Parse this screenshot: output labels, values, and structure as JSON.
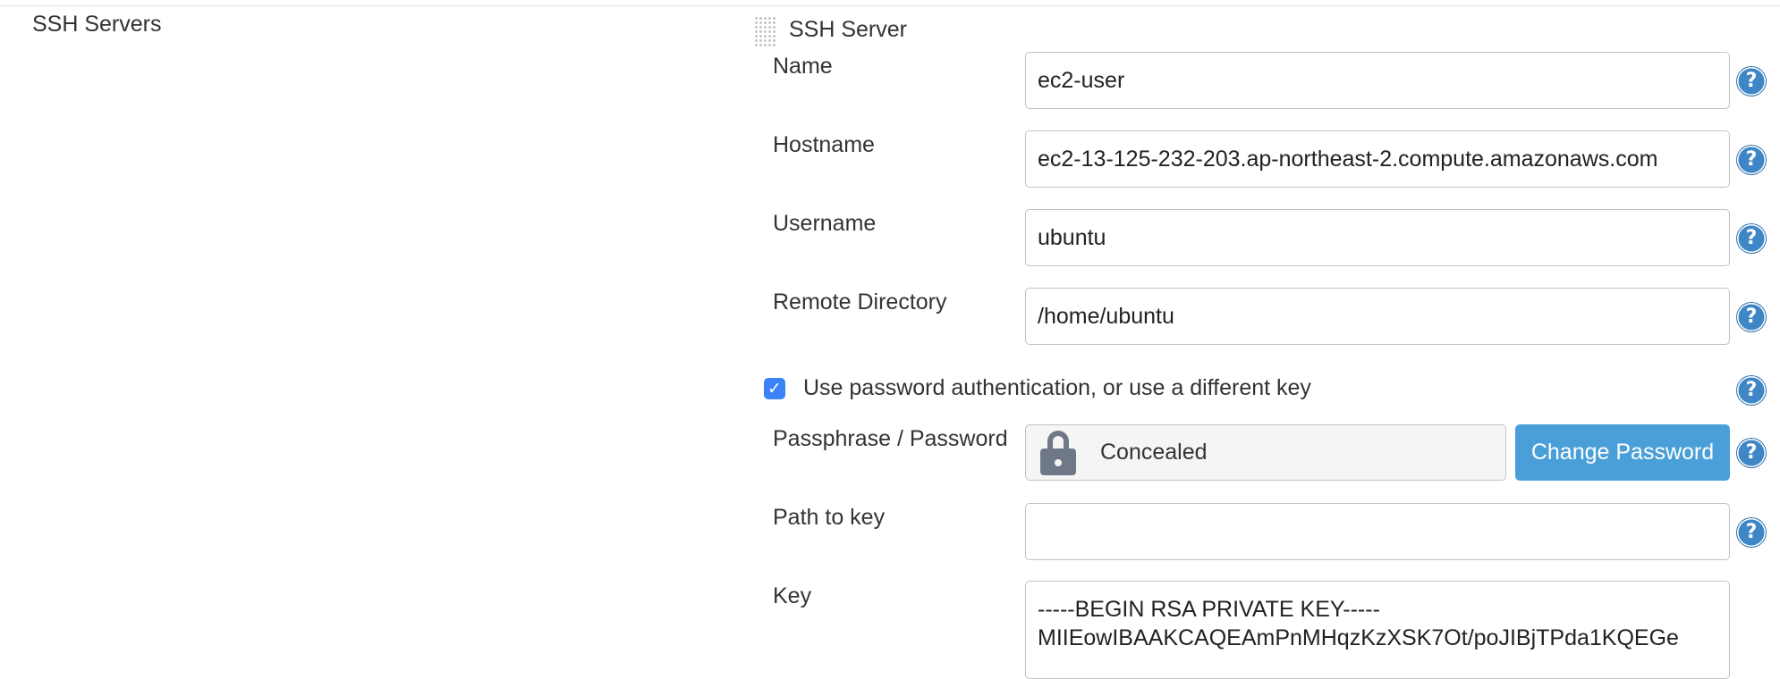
{
  "section": {
    "title": "SSH Servers"
  },
  "server": {
    "title": "SSH Server",
    "name_label": "Name",
    "name_value": "ec2-user",
    "hostname_label": "Hostname",
    "hostname_value": "ec2-13-125-232-203.ap-northeast-2.compute.amazonaws.com",
    "username_label": "Username",
    "username_value": "ubuntu",
    "remote_dir_label": "Remote Directory",
    "remote_dir_value": "/home/ubuntu",
    "use_password_label": "Use password authentication, or use a different key",
    "use_password_checked": true,
    "passphrase_label": "Passphrase / Password",
    "passphrase_status": "Concealed",
    "change_password_label": "Change Password",
    "path_to_key_label": "Path to key",
    "path_to_key_value": "",
    "key_label": "Key",
    "key_value": "-----BEGIN RSA PRIVATE KEY-----\nMIIEowIBAAKCAQEAmPnMHqzKzXSK7Ot/poJIBjTPda1KQEGe"
  },
  "help_icon_glyph": "?",
  "checkbox_glyph": "✓",
  "colors": {
    "primary_button": "#4a9fd8",
    "help_icon": "#3f86c6",
    "checkbox": "#3b82f6"
  },
  "icons": [
    "drag-handle-icon",
    "lock-icon",
    "help-icon",
    "checkmark-icon"
  ]
}
